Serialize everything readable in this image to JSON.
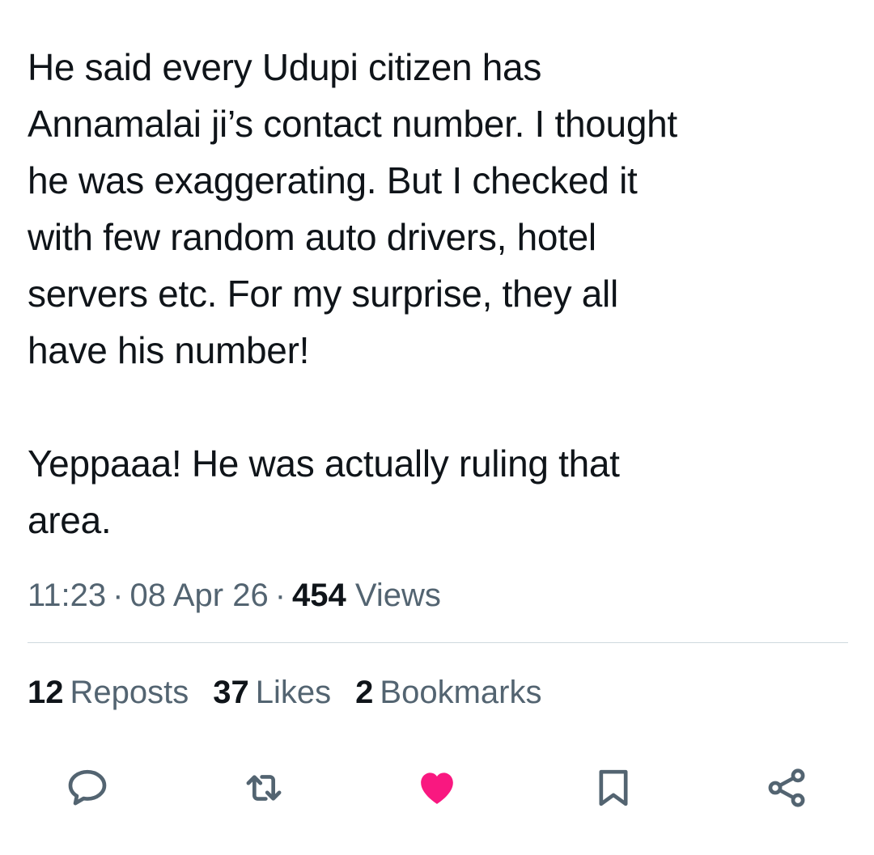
{
  "tweet": {
    "text": "He said every Udupi citizen has\nAnnamalai ji’s contact number. I thought\nhe was exaggerating. But I checked it\nwith few random auto drivers, hotel\nservers etc. For my surprise, they all\nhave his number!\n\nYeppaaa! He was actually ruling that\narea.",
    "time": "11:23",
    "separator": "·",
    "date": "08 Apr 26",
    "views_count": "454",
    "views_label": "Views"
  },
  "stats": {
    "reposts_count": "12",
    "reposts_label": "Reposts",
    "likes_count": "37",
    "likes_label": "Likes",
    "bookmarks_count": "2",
    "bookmarks_label": "Bookmarks"
  },
  "actions": [
    {
      "icon": "reply-icon",
      "color": "#536471"
    },
    {
      "icon": "repost-icon",
      "color": "#536471"
    },
    {
      "icon": "heart-icon",
      "color": "#f91880",
      "active": true
    },
    {
      "icon": "bookmark-icon",
      "color": "#536471"
    },
    {
      "icon": "share-icon",
      "color": "#536471"
    }
  ]
}
